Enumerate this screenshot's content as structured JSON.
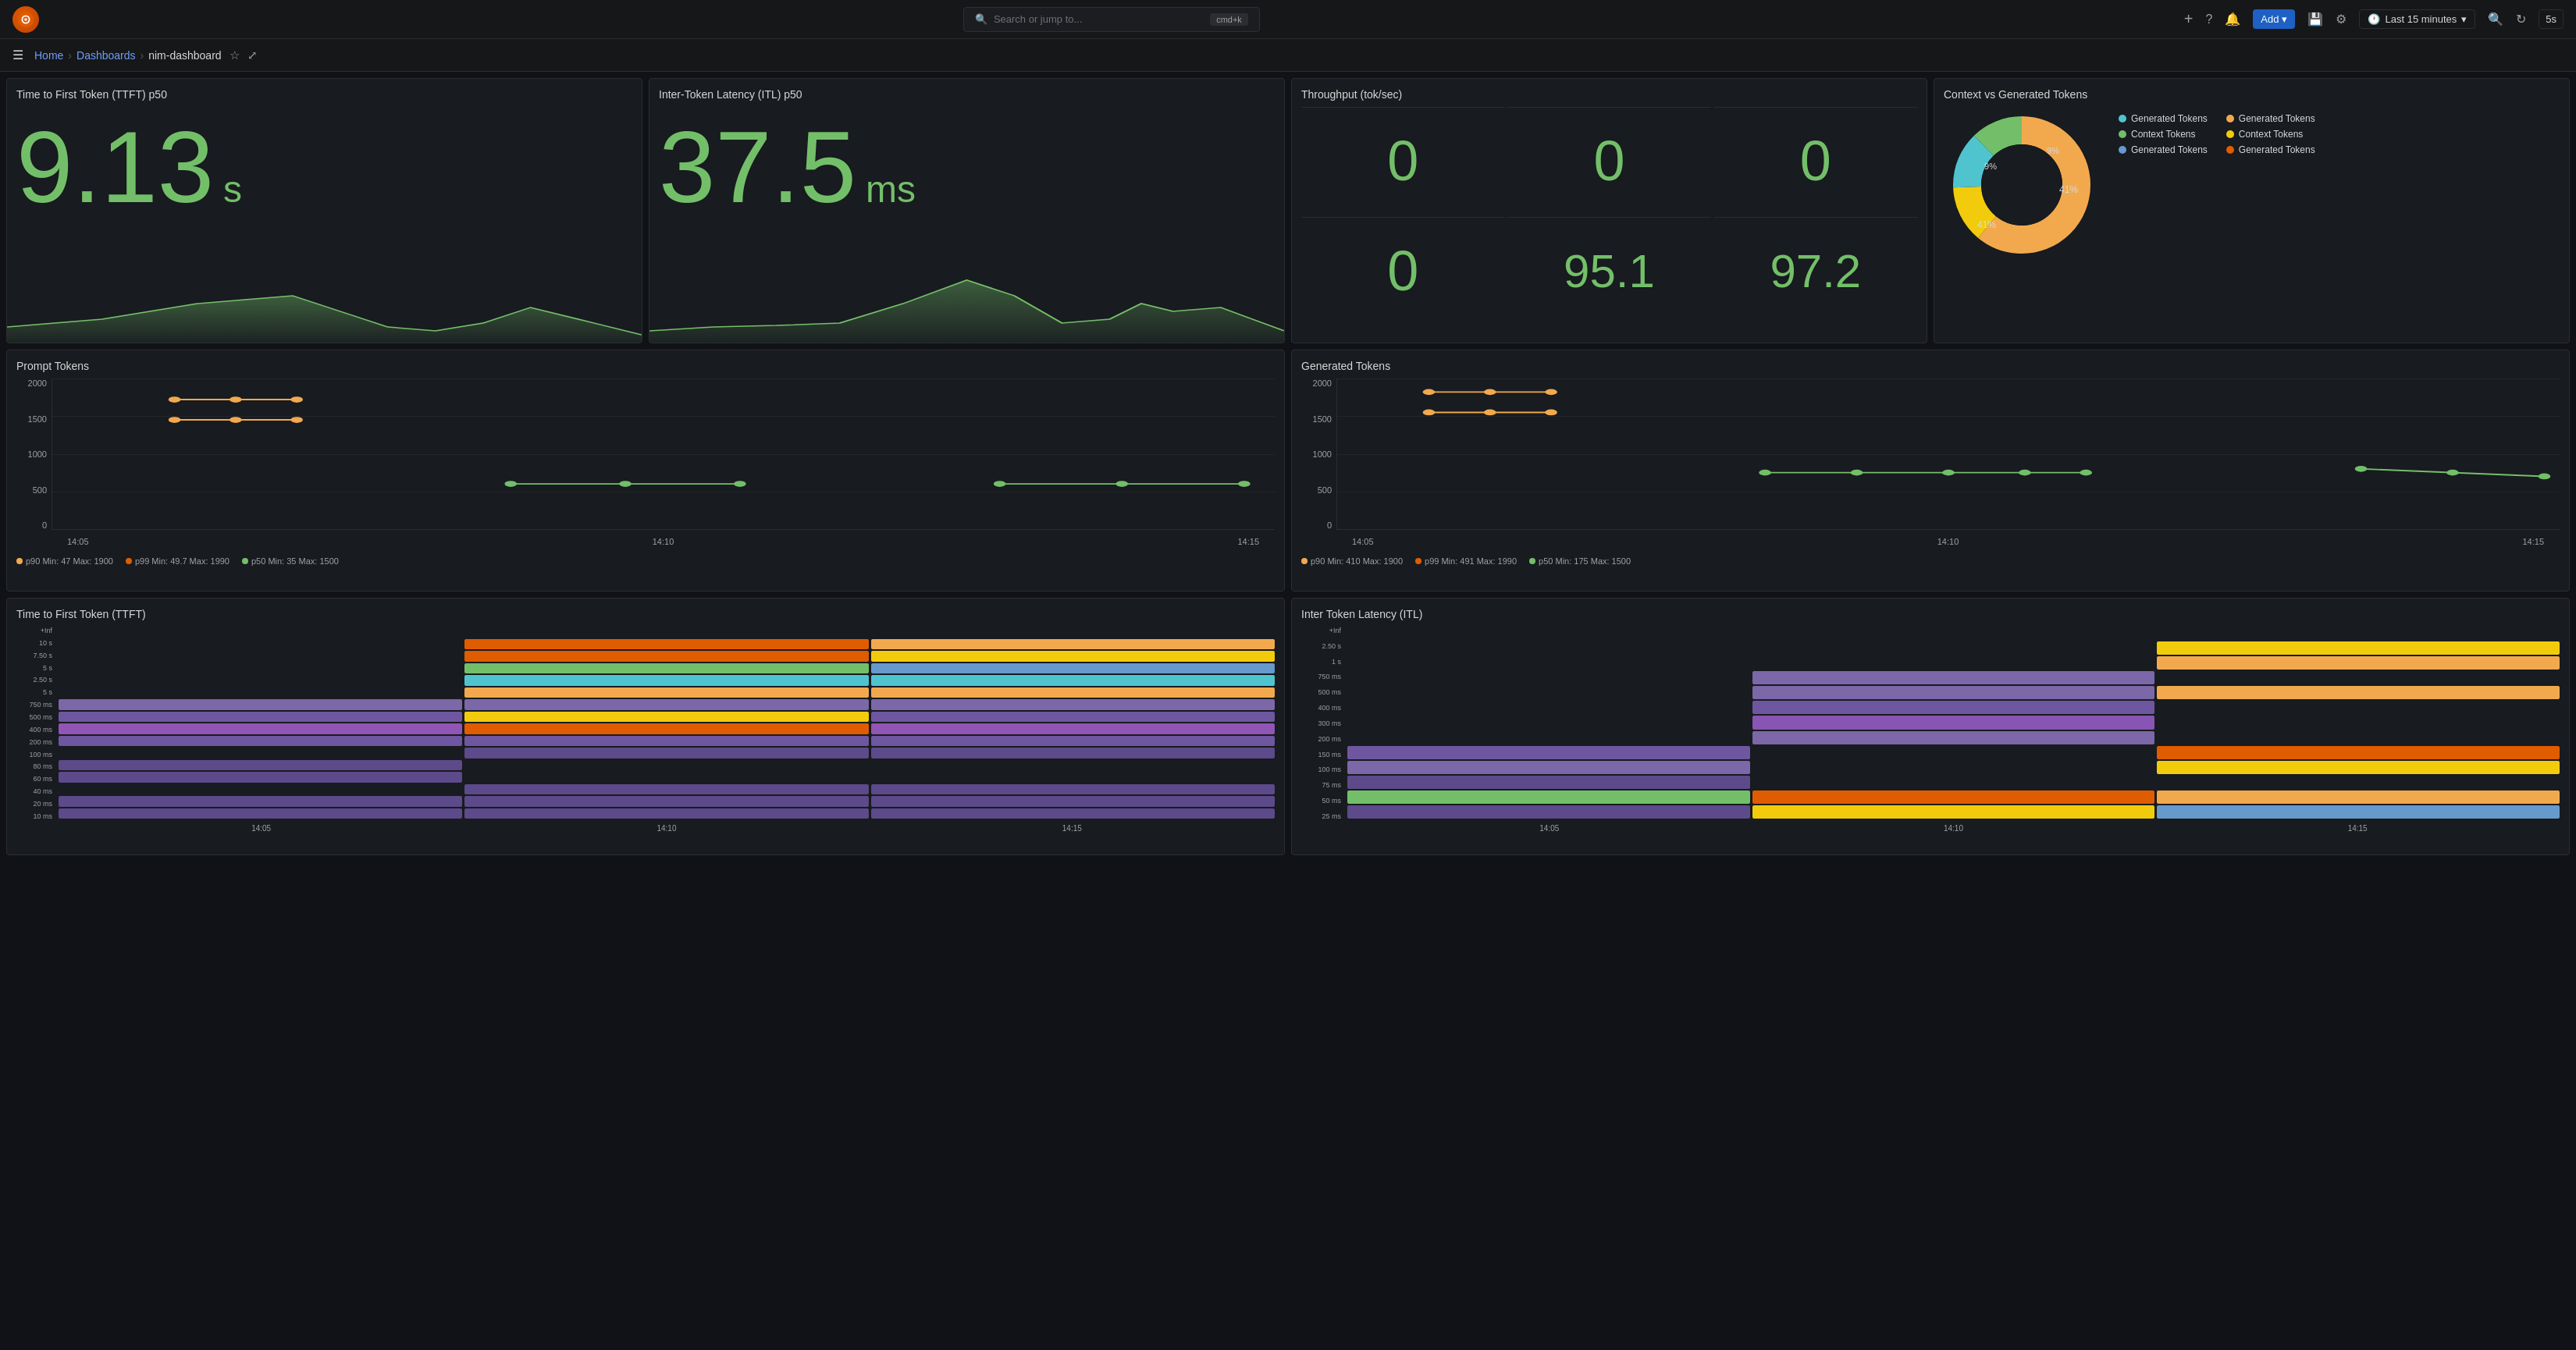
{
  "nav": {
    "logo_text": "G",
    "search_placeholder": "Search or jump to...",
    "search_shortcut": "cmd+k",
    "add_label": "Add",
    "time_label": "Last 15 minutes",
    "refresh_rate": "5s",
    "breadcrumb": [
      "Home",
      "Dashboards",
      "nim-dashboard"
    ]
  },
  "panels": {
    "ttft": {
      "title": "Time to First Token (TTFT) p50",
      "value": "9.13",
      "unit": "s"
    },
    "itl": {
      "title": "Inter-Token Latency (ITL) p50",
      "value": "37.5",
      "unit": "ms"
    },
    "throughput": {
      "title": "Throughput (tok/sec)",
      "cells": [
        "0",
        "0",
        "0",
        "0",
        "95.1",
        "97.2"
      ]
    },
    "context": {
      "title": "Context vs Generated Tokens",
      "legend": [
        {
          "label": "Generated Tokens",
          "color": "#4fc4cf"
        },
        {
          "label": "Generated Tokens",
          "color": "#f2a94e"
        },
        {
          "label": "Context Tokens",
          "color": "#73bf69"
        },
        {
          "label": "Context Tokens",
          "color": "#f2cc0c"
        },
        {
          "label": "Generated Tokens",
          "color": "#6699cc"
        },
        {
          "label": "Generated Tokens",
          "color": "#e05c00"
        }
      ],
      "donut": {
        "segments": [
          {
            "pct": 41,
            "color": "#f2a94e",
            "label": "41%"
          },
          {
            "pct": 9,
            "color": "#f2cc0c",
            "label": "9%"
          },
          {
            "pct": 9,
            "color": "#4fc4cf",
            "label": "9%"
          },
          {
            "pct": 41,
            "color": "#73bf69",
            "label": "41%"
          }
        ]
      }
    },
    "prompt_tokens": {
      "title": "Prompt Tokens",
      "y_labels": [
        "2000",
        "1500",
        "1000",
        "500",
        "0"
      ],
      "x_labels": [
        "14:05",
        "14:10",
        "14:15"
      ],
      "legend": [
        {
          "label": "p90  Min: 47  Max: 1900",
          "color": "#f2a94e"
        },
        {
          "label": "p99  Min: 49.7  Max: 1990",
          "color": "#e05c00"
        },
        {
          "label": "p50  Min: 35  Max: 1500",
          "color": "#73bf69"
        }
      ]
    },
    "generated_tokens": {
      "title": "Generated Tokens",
      "y_labels": [
        "2000",
        "1500",
        "1000",
        "500",
        "0"
      ],
      "x_labels": [
        "14:05",
        "14:10",
        "14:15"
      ],
      "legend": [
        {
          "label": "p90  Min: 410  Max: 1900",
          "color": "#f2a94e"
        },
        {
          "label": "p99  Min: 491  Max: 1990",
          "color": "#e05c00"
        },
        {
          "label": "p50  Min: 175  Max: 1500",
          "color": "#73bf69"
        }
      ]
    },
    "ttft_heatmap": {
      "title": "Time to First Token (TTFT)",
      "y_labels": [
        "+Inf",
        "10 s",
        "7.50 s",
        "5 s",
        "2.50 s",
        "5 s",
        "750 ms",
        "500 ms",
        "400 ms",
        "200 ms",
        "100 ms",
        "80 ms",
        "60 ms",
        "40 ms",
        "20 ms",
        "10 ms"
      ],
      "x_labels": [
        "14:05",
        "14:10",
        "14:15"
      ]
    },
    "itl_heatmap": {
      "title": "Inter Token Latency (ITL)",
      "y_labels": [
        "+Inf",
        "2.50 s",
        "1 s",
        "750 ms",
        "500 ms",
        "400 ms",
        "300 ms",
        "200 ms",
        "150 ms",
        "100 ms",
        "75 ms",
        "50 ms",
        "25 ms"
      ],
      "x_labels": [
        "14:05",
        "14:10",
        "14:15"
      ]
    }
  }
}
